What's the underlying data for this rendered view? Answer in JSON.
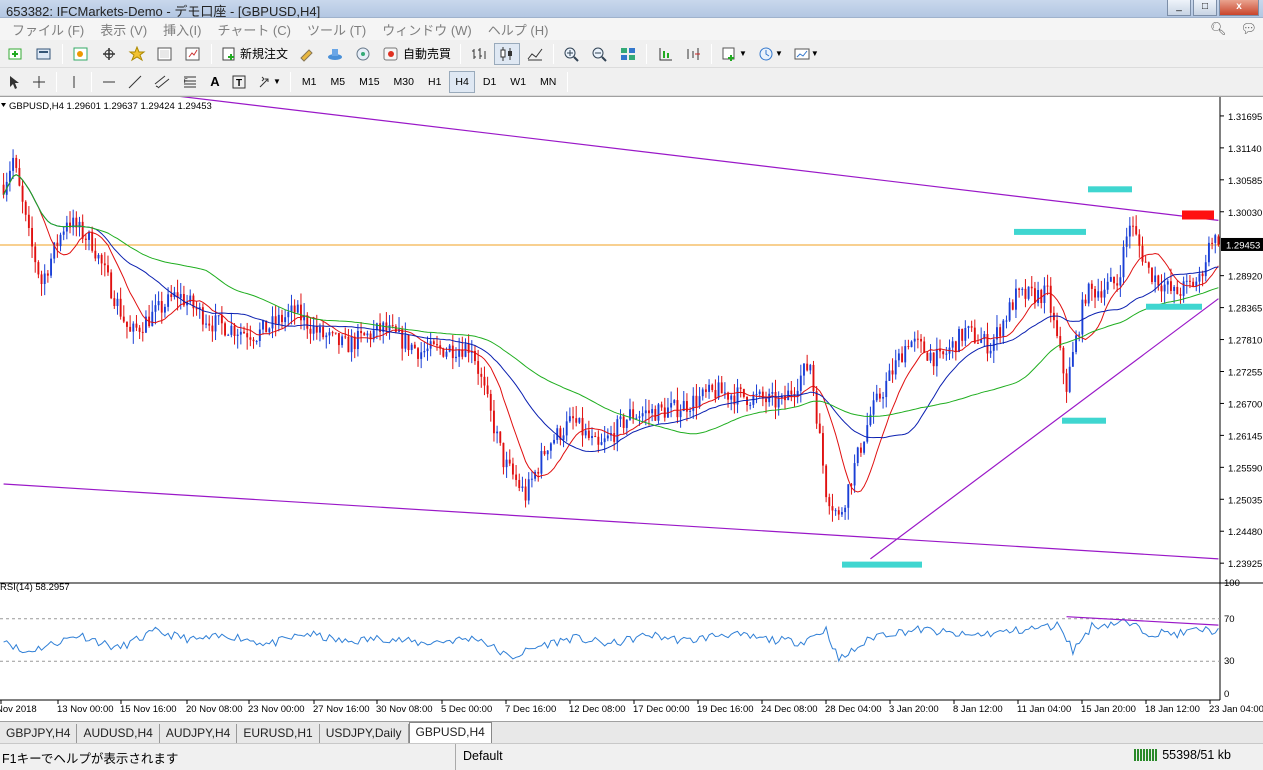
{
  "window": {
    "title": "653382: IFCMarkets-Demo - デモ口座 - [GBPUSD,H4]",
    "controls": [
      "_",
      "□",
      "x"
    ]
  },
  "menu": [
    "ファイル (F)",
    "表示 (V)",
    "挿入(I)",
    "チャート (C)",
    "ツール (T)",
    "ウィンドウ (W)",
    "ヘルプ (H)"
  ],
  "toolbar": {
    "new_order": "新規注文",
    "auto_trading": "自動売買"
  },
  "timeframes": [
    "M1",
    "M5",
    "M15",
    "M30",
    "H1",
    "H4",
    "D1",
    "W1",
    "MN"
  ],
  "active_timeframe": "H4",
  "chart_info": "GBPUSD,H4  1.29601 1.29637 1.29424 1.29453",
  "rsi_label": "RSI(14) 58.2957",
  "price_labels": [
    "1.31695",
    "1.31140",
    "1.30585",
    "1.30030",
    "1.29453",
    "1.28920",
    "1.28365",
    "1.27810",
    "1.27255",
    "1.26700",
    "1.26145",
    "1.25590",
    "1.25035",
    "1.24480",
    "1.23925"
  ],
  "current_price": "1.29453",
  "rsi_levels": [
    "100",
    "70",
    "30",
    "0"
  ],
  "date_labels": [
    "Nov 2018",
    "13 Nov 00:00",
    "15 Nov 16:00",
    "20 Nov 08:00",
    "23 Nov 00:00",
    "27 Nov 16:00",
    "30 Nov 08:00",
    "5 Dec 00:00",
    "7 Dec 16:00",
    "12 Dec 08:00",
    "17 Dec 00:00",
    "19 Dec 16:00",
    "24 Dec 08:00",
    "28 Dec 04:00",
    "3 Jan 20:00",
    "8 Jan 12:00",
    "11 Jan 04:00",
    "15 Jan 20:00",
    "18 Jan 12:00",
    "23 Jan 04:00"
  ],
  "tabs": [
    "GBPJPY,H4",
    "AUDUSD,H4",
    "AUDJPY,H4",
    "EURUSD,H1",
    "USDJPY,Daily",
    "GBPUSD,H4"
  ],
  "active_tab": "GBPUSD,H4",
  "status": {
    "help": "F1キーでヘルプが表示されます",
    "profile": "Default",
    "traffic": "55398/51 kb"
  },
  "colors": {
    "up_candle": "#1a3fd6",
    "down_candle": "#e01010",
    "ma_fast": "#e01010",
    "ma_mid": "#0a1fb0",
    "ma_slow": "#1fae1f",
    "trendline": "#9a18c8",
    "price_line": "#f0a020",
    "marker": "#3fd6d0",
    "marker_red": "#ff1010",
    "rsi_line": "#2f7fd6"
  },
  "chart_data": {
    "type": "candlestick",
    "symbol": "GBPUSD",
    "timeframe": "H4",
    "ylim": [
      1.2365,
      1.3185
    ],
    "control_points": [
      [
        0,
        1.305
      ],
      [
        3,
        1.3095
      ],
      [
        8,
        1.296
      ],
      [
        12,
        1.288
      ],
      [
        20,
        1.299
      ],
      [
        28,
        1.295
      ],
      [
        40,
        1.279
      ],
      [
        55,
        1.286
      ],
      [
        66,
        1.281
      ],
      [
        80,
        1.279
      ],
      [
        92,
        1.283
      ],
      [
        100,
        1.279
      ],
      [
        108,
        1.277
      ],
      [
        120,
        1.28
      ],
      [
        132,
        1.276
      ],
      [
        148,
        1.277
      ],
      [
        158,
        1.257
      ],
      [
        165,
        1.251
      ],
      [
        172,
        1.26
      ],
      [
        180,
        1.264
      ],
      [
        188,
        1.259
      ],
      [
        198,
        1.265
      ],
      [
        212,
        1.266
      ],
      [
        225,
        1.269
      ],
      [
        237,
        1.268
      ],
      [
        246,
        1.267
      ],
      [
        255,
        1.274
      ],
      [
        260,
        1.252
      ],
      [
        264,
        1.247
      ],
      [
        274,
        1.265
      ],
      [
        286,
        1.278
      ],
      [
        296,
        1.2745
      ],
      [
        304,
        1.2795
      ],
      [
        312,
        1.277
      ],
      [
        320,
        1.2855
      ],
      [
        330,
        1.286
      ],
      [
        336,
        1.27
      ],
      [
        342,
        1.286
      ],
      [
        352,
        1.288
      ],
      [
        356,
        1.2985
      ],
      [
        362,
        1.29
      ],
      [
        370,
        1.286
      ],
      [
        378,
        1.2885
      ],
      [
        382,
        1.2962
      ],
      [
        384,
        1.2945
      ]
    ],
    "rsi_control": [
      [
        0,
        52
      ],
      [
        6,
        38
      ],
      [
        14,
        45
      ],
      [
        24,
        55
      ],
      [
        36,
        42
      ],
      [
        48,
        58
      ],
      [
        60,
        50
      ],
      [
        72,
        54
      ],
      [
        84,
        46
      ],
      [
        96,
        56
      ],
      [
        108,
        48
      ],
      [
        120,
        52
      ],
      [
        132,
        47
      ],
      [
        150,
        52
      ],
      [
        160,
        33
      ],
      [
        170,
        45
      ],
      [
        180,
        52
      ],
      [
        192,
        46
      ],
      [
        204,
        55
      ],
      [
        216,
        49
      ],
      [
        228,
        56
      ],
      [
        240,
        51
      ],
      [
        252,
        48
      ],
      [
        260,
        60
      ],
      [
        264,
        31
      ],
      [
        276,
        55
      ],
      [
        290,
        60
      ],
      [
        304,
        54
      ],
      [
        318,
        58
      ],
      [
        334,
        64
      ],
      [
        338,
        40
      ],
      [
        344,
        63
      ],
      [
        354,
        67
      ],
      [
        362,
        57
      ],
      [
        372,
        56
      ],
      [
        378,
        60
      ],
      [
        384,
        58
      ]
    ],
    "bars": 385,
    "trendlines": [
      {
        "from": [
          0,
          1.324
        ],
        "to": [
          384,
          1.2988
        ]
      },
      {
        "from": [
          0,
          1.253
        ],
        "to": [
          384,
          1.24
        ]
      },
      {
        "from": [
          274,
          1.24
        ],
        "to": [
          384,
          1.2852
        ]
      }
    ],
    "rsi_trendline": {
      "from": [
        336,
        72
      ],
      "to": [
        384,
        64
      ]
    },
    "ma": [
      {
        "name": "fast",
        "period": 12
      },
      {
        "name": "mid",
        "period": 30
      },
      {
        "name": "slow",
        "period": 65
      }
    ]
  }
}
